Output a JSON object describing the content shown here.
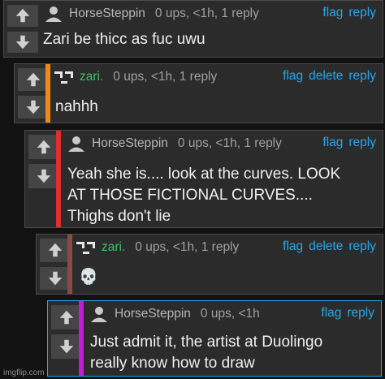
{
  "actions": {
    "flag": "flag",
    "reply": "reply",
    "delete": "delete"
  },
  "comments": [
    {
      "user": "HorseSteppin",
      "meta": "0 ups, <1h, 1 reply",
      "body": [
        "Zari be thicc as fuc uwu"
      ],
      "bar_color": "",
      "user_color": "#b5b5b5"
    },
    {
      "user": "zari.",
      "meta": "0 ups, <1h, 1 reply",
      "body": [
        "nahhh"
      ],
      "bar_color": "#f08a14",
      "user_color": "#3cc26a"
    },
    {
      "user": "HorseSteppin",
      "meta": "0 ups, <1h, 1 reply",
      "body": [
        "Yeah she is.... look at the curves. LOOK",
        "AT THOSE FICTIONAL CURVES....",
        "Thighs don't lie"
      ],
      "bar_color": "#e02d2d",
      "user_color": "#b5b5b5"
    },
    {
      "user": "zari.",
      "meta": "0 ups, <1h, 1 reply",
      "body": [
        "💀"
      ],
      "bar_color": "#8a4a4a",
      "user_color": "#3cc26a"
    },
    {
      "user": "HorseSteppin",
      "meta": "0 ups, <1h",
      "body": [
        "Just admit it, the artist at Duolingo",
        "really know how to draw"
      ],
      "bar_color": "#c21ad6",
      "user_color": "#b5b5b5"
    }
  ],
  "watermark": "imgflip.com"
}
